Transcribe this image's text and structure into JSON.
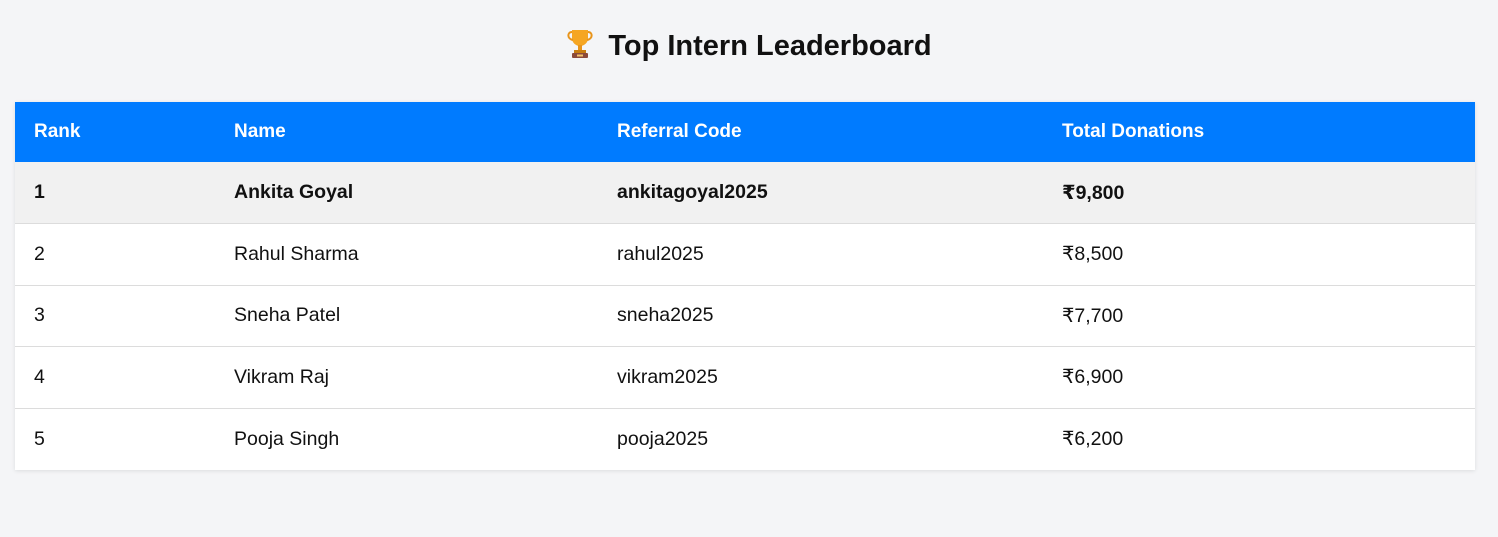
{
  "page": {
    "title": "Top Intern Leaderboard",
    "title_icon": "trophy-icon"
  },
  "colors": {
    "header_bg": "#007bff",
    "page_bg": "#f4f5f7",
    "highlight_row_bg": "#f1f1f1"
  },
  "table": {
    "headers": {
      "rank": "Rank",
      "name": "Name",
      "code": "Referral Code",
      "donations": "Total Donations"
    },
    "rows": [
      {
        "rank": "1",
        "name": "Ankita Goyal",
        "code": "ankitagoyal2025",
        "donations": "₹9,800"
      },
      {
        "rank": "2",
        "name": "Rahul Sharma",
        "code": "rahul2025",
        "donations": "₹8,500"
      },
      {
        "rank": "3",
        "name": "Sneha Patel",
        "code": "sneha2025",
        "donations": "₹7,700"
      },
      {
        "rank": "4",
        "name": "Vikram Raj",
        "code": "vikram2025",
        "donations": "₹6,900"
      },
      {
        "rank": "5",
        "name": "Pooja Singh",
        "code": "pooja2025",
        "donations": "₹6,200"
      }
    ]
  }
}
